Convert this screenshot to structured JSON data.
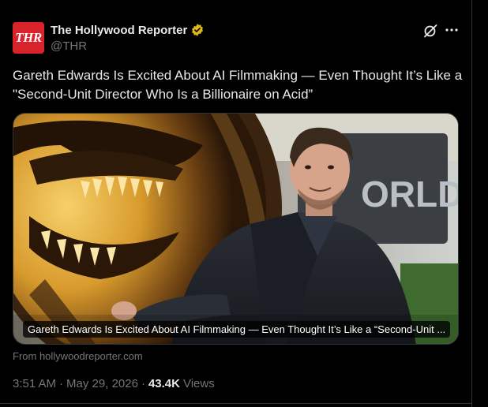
{
  "account": {
    "avatar_text": "THR",
    "display_name": "The Hollywood Reporter",
    "handle": "@THR",
    "verified_color": "#e2b719"
  },
  "icons": {
    "grok": "grok-icon",
    "more": "more-icon",
    "verified": "verified-badge-icon"
  },
  "tweet": {
    "text": "Gareth Edwards Is Excited About AI Filmmaking — Even Thought It’s Like a \"Second-Unit Director Who Is a Billionaire on Acid”"
  },
  "card": {
    "caption": "Gareth Edwards Is Excited About AI Filmmaking — Even Thought It’s Like a “Second-Unit ...",
    "source": "From hollywoodreporter.com",
    "sign_text": "ORLD"
  },
  "meta": {
    "time": "3:51 AM",
    "sep1": "·",
    "date": "May 29, 2026",
    "sep2": "·",
    "views_count": "43.4K",
    "views_label": "Views"
  },
  "colors": {
    "background": "#000000",
    "text_primary": "#e7e9ea",
    "text_secondary": "#71767b",
    "brand_red": "#d9232b",
    "border": "#2f3336"
  }
}
